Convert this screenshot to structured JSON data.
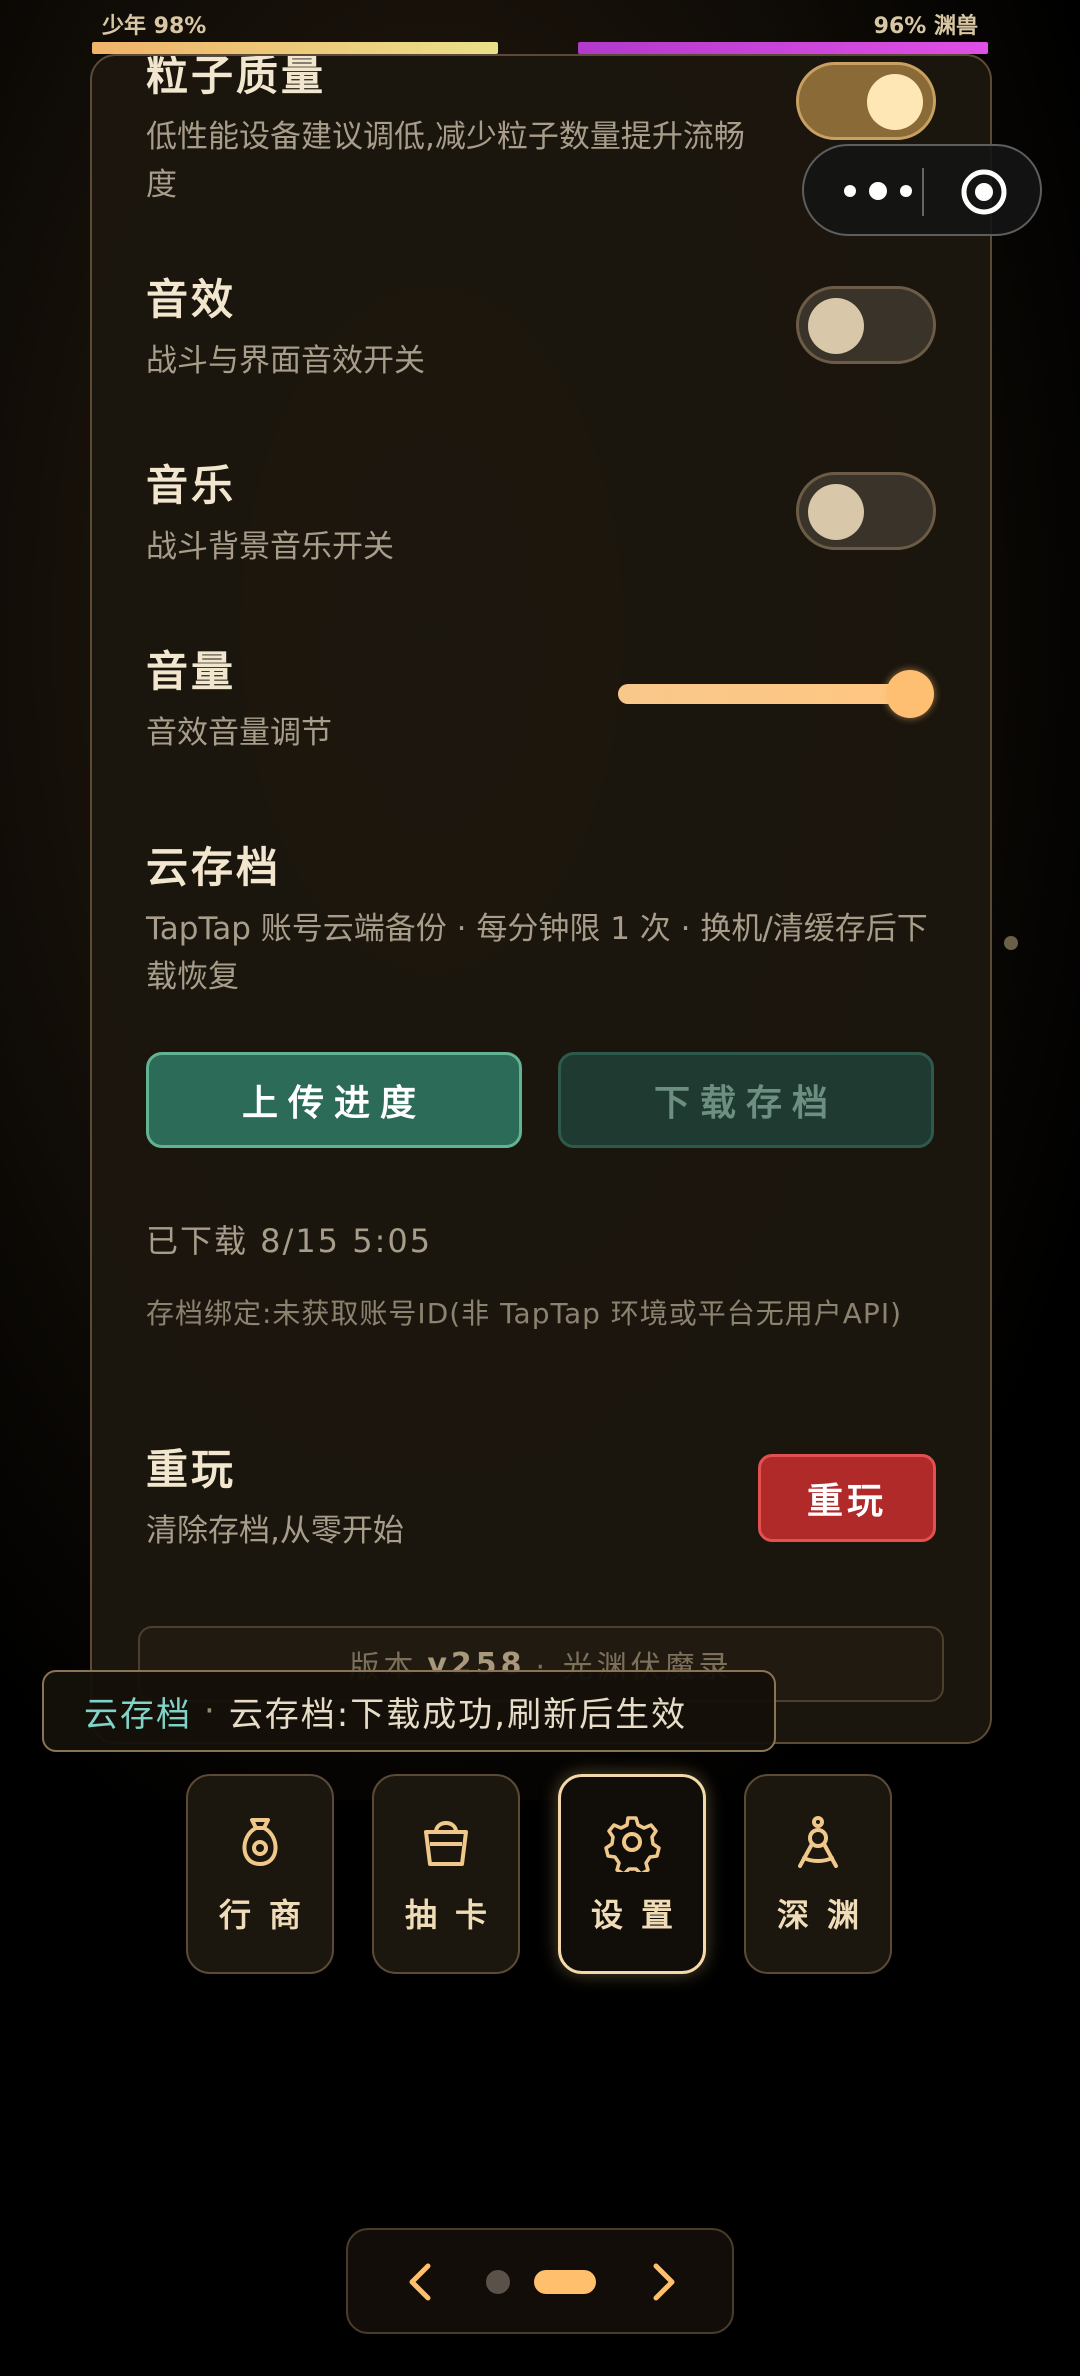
{
  "top_bar": {
    "player_label": "少年 98%",
    "enemy_label": "96% 渊兽",
    "player_hp_percent": 98,
    "enemy_hp_percent": 96
  },
  "capsule": {
    "more_icon": "more-dots-icon",
    "close_icon": "target-circle-icon"
  },
  "settings": {
    "particle": {
      "title": "粒子质量",
      "desc": "低性能设备建议调低,减少粒子数量提升流畅度",
      "enabled": true
    },
    "sfx": {
      "title": "音效",
      "desc": "战斗与界面音效开关",
      "enabled": false
    },
    "music": {
      "title": "音乐",
      "desc": "战斗背景音乐开关",
      "enabled": false
    },
    "volume": {
      "title": "音量",
      "desc": "音效音量调节",
      "value": 1.0
    },
    "cloud": {
      "title": "云存档",
      "desc": "TapTap 账号云端备份 · 每分钟限 1 次 · 换机/清缓存后下载恢复",
      "upload_label": "上传进度",
      "download_label": "下载存档",
      "downloaded_status": "已下载 8/15 5:05",
      "bind_info": "存档绑定:未获取账号ID(非 TapTap 环境或平台无用户API)"
    },
    "replay": {
      "title": "重玩",
      "desc": "清除存档,从零开始",
      "button_label": "重玩"
    },
    "version": {
      "prefix": "版本",
      "number": "v258",
      "suffix": "· 光渊伏魔录"
    }
  },
  "toast": {
    "tag": "云存档",
    "message": "云存档:下载成功,刷新后生效"
  },
  "nav": {
    "items": [
      {
        "label": "行商",
        "icon": "money-bag-icon",
        "active": false
      },
      {
        "label": "抽卡",
        "icon": "basket-icon",
        "active": false
      },
      {
        "label": "设置",
        "icon": "gear-icon",
        "active": true
      },
      {
        "label": "深渊",
        "icon": "compass-icon",
        "active": false
      }
    ]
  },
  "pager": {
    "prev_icon": "chevron-left-icon",
    "next_icon": "chevron-right-icon",
    "current_page": 2,
    "page_count": 2
  },
  "colors": {
    "accent": "#ffbf6d",
    "upload_green": "#2b6b58",
    "danger_red": "#b02a2a",
    "toast_tag": "#7fd3c7"
  }
}
